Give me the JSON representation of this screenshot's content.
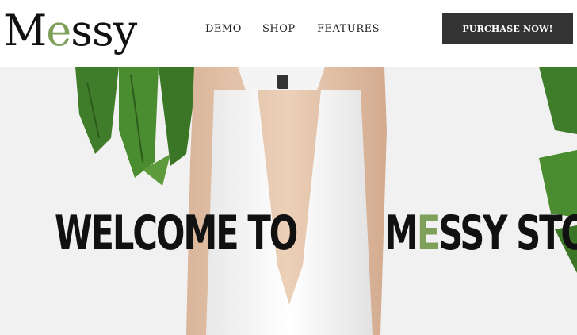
{
  "header": {
    "logo": {
      "first": "M",
      "accent": "e",
      "rest": "ssy"
    },
    "nav": [
      {
        "label": "DEMO"
      },
      {
        "label": "SHOP"
      },
      {
        "label": "FEATURES"
      }
    ],
    "cta_label": "PURCHASE NOW!"
  },
  "hero": {
    "headline_left": "WELCOME TO",
    "headline_right_first": "M",
    "headline_right_accent": "E",
    "headline_right_rest": "SSY STORE",
    "background_color": "#f2f1f1",
    "leaf_color": "#3f7d2a",
    "accent_color": "#7fa05a"
  }
}
